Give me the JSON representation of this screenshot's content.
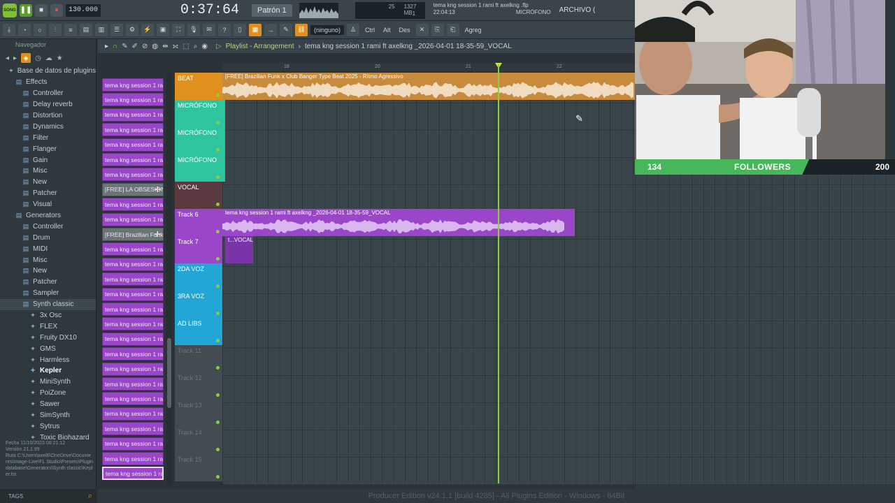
{
  "topbar": {
    "logo": "SONG",
    "tempo": "130.000",
    "time": "0:37:64",
    "pattern": "Patrón 1",
    "cpu_value": "25",
    "memory": "1327 MB",
    "voices": "1",
    "hint_file": "tema kng session 1 rami ft axelkng .flp",
    "hint_time": "22:04:13",
    "hint_channel": "MICRÓFONO",
    "archivo": "ARCHIVO ("
  },
  "toolbar2": {
    "ninguno": "(ninguno)",
    "ctrl": "Ctrl",
    "alt": "Alt",
    "des": "Des",
    "agreg": "Agreg"
  },
  "browser": {
    "navigator": "Navegador",
    "root": "Base de datos de plugins",
    "items": [
      {
        "label": "Effects",
        "level": 1,
        "icon": "folder"
      },
      {
        "label": "Controller",
        "level": 2,
        "icon": "folder"
      },
      {
        "label": "Delay reverb",
        "level": 2,
        "icon": "folder"
      },
      {
        "label": "Distortion",
        "level": 2,
        "icon": "folder"
      },
      {
        "label": "Dynamics",
        "level": 2,
        "icon": "folder"
      },
      {
        "label": "Filter",
        "level": 2,
        "icon": "folder"
      },
      {
        "label": "Flanger",
        "level": 2,
        "icon": "folder"
      },
      {
        "label": "Gain",
        "level": 2,
        "icon": "folder"
      },
      {
        "label": "Misc",
        "level": 2,
        "icon": "folder"
      },
      {
        "label": "New",
        "level": 2,
        "icon": "folder"
      },
      {
        "label": "Patcher",
        "level": 2,
        "icon": "folder"
      },
      {
        "label": "Visual",
        "level": 2,
        "icon": "folder"
      },
      {
        "label": "Generators",
        "level": 1,
        "icon": "folder"
      },
      {
        "label": "Controller",
        "level": 2,
        "icon": "folder"
      },
      {
        "label": "Drum",
        "level": 2,
        "icon": "folder"
      },
      {
        "label": "MIDI",
        "level": 2,
        "icon": "folder"
      },
      {
        "label": "Misc",
        "level": 2,
        "icon": "folder"
      },
      {
        "label": "New",
        "level": 2,
        "icon": "folder"
      },
      {
        "label": "Patcher",
        "level": 2,
        "icon": "folder"
      },
      {
        "label": "Sampler",
        "level": 2,
        "icon": "folder"
      },
      {
        "label": "Synth classic",
        "level": 2,
        "icon": "folder",
        "selected": true
      },
      {
        "label": "3x Osc",
        "level": 3,
        "icon": "plugin"
      },
      {
        "label": "FLEX",
        "level": 3,
        "icon": "plugin"
      },
      {
        "label": "Fruity DX10",
        "level": 3,
        "icon": "plugin"
      },
      {
        "label": "GMS",
        "level": 3,
        "icon": "plugin"
      },
      {
        "label": "Harmless",
        "level": 3,
        "icon": "plugin"
      },
      {
        "label": "Kepler",
        "level": 3,
        "icon": "plugin",
        "bold": true
      },
      {
        "label": "MiniSynth",
        "level": 3,
        "icon": "plugin"
      },
      {
        "label": "PoiZone",
        "level": 3,
        "icon": "plugin"
      },
      {
        "label": "Sawer",
        "level": 3,
        "icon": "plugin"
      },
      {
        "label": "SimSynth",
        "level": 3,
        "icon": "plugin"
      },
      {
        "label": "Sytrus",
        "level": 3,
        "icon": "plugin"
      },
      {
        "label": "Toxic Biohazard",
        "level": 3,
        "icon": "plugin"
      }
    ],
    "info": {
      "fecha_label": "Fecha",
      "fecha": "11/10/2023 08:21:12",
      "version_label": "Versión",
      "version": "21.1.99",
      "ruta_label": "Ruta",
      "ruta": "C:\\Users\\axel6\\OneDrive\\Documents\\Image-Line\\FL Studio\\Presets\\Plugin database\\Generators\\Synth classic\\Kepler.fst"
    },
    "tags": "TAGS"
  },
  "channels": [
    "tema kng session 1 rami...",
    "tema kng session 1 rami...",
    "tema kng session 1 rami...",
    "tema kng session 1 rami...",
    "tema kng session 1 rami...",
    "tema kng session 1 rami...",
    "tema kng session 1 rami...",
    "[FREE] LA OBSESION...",
    "tema kng session 1 rami...",
    "tema kng session 1 rami...",
    "[FREE] Brazilian Funk...",
    "tema kng session 1 rami...",
    "tema kng session 1 rami...",
    "tema kng session 1 rami...",
    "tema kng session 1 rami...",
    "tema kng session 1 rami...",
    "tema kng session 1 rami...",
    "tema kng session 1 rami...",
    "tema kng session 1 rami...",
    "tema kng session 1 rami...",
    "tema kng session 1 rami...",
    "tema kng session 1 rami...",
    "tema kng session 1 rami...",
    "tema kng session 1 rami...",
    "tema kng session 1 rami...",
    "tema kng session 1 rami...",
    "tema kng session 1 rami..."
  ],
  "playlist": {
    "header": "Playlist - Arrangement",
    "pattern_path": "tema kng session 1 rami ft axelkng _2026-04-01 18-35-59_VOCAL",
    "ruler": [
      "18",
      "20",
      "21",
      "22"
    ],
    "tracks": [
      {
        "name": "BEAT",
        "color": "#e0901d"
      },
      {
        "name": "MICRÓFONO",
        "color": "#2fc4a0"
      },
      {
        "name": "MICRÓFONO",
        "color": "#2fc4a0"
      },
      {
        "name": "MICRÓFONO",
        "color": "#2fc4a0"
      },
      {
        "name": "VOCAL",
        "color": "#5a3a3e"
      },
      {
        "name": "Track 6",
        "color": "#9a46c9"
      },
      {
        "name": "Track 7",
        "color": "#9a46c9"
      },
      {
        "name": "2DA VOZ",
        "color": "#21a6d6"
      },
      {
        "name": "3RA VOZ",
        "color": "#21a6d6"
      },
      {
        "name": "AD LIBS",
        "color": "#21a6d6"
      },
      {
        "name": "Track 11",
        "color": ""
      },
      {
        "name": "Track 12",
        "color": ""
      },
      {
        "name": "Track 13",
        "color": ""
      },
      {
        "name": "Track 14",
        "color": ""
      },
      {
        "name": "Track 15",
        "color": ""
      }
    ],
    "clips": {
      "beat": "[FREE] Brazilian Funk x Club Banger Type Beat 2025 - Ritmo Agressivo",
      "vocal": "tema kng session 1 rami ft axelkng _2026-04-01 18-35-59_VOCAL",
      "small": "t...VOCAL"
    }
  },
  "followers": {
    "current": "134",
    "label": "FOLLOWERS",
    "goal": "200",
    "progress": 0.67
  },
  "status": "Producer Edition v24.1.1 [build 4285] - All Plugins Edition - Windows - 64Bit"
}
